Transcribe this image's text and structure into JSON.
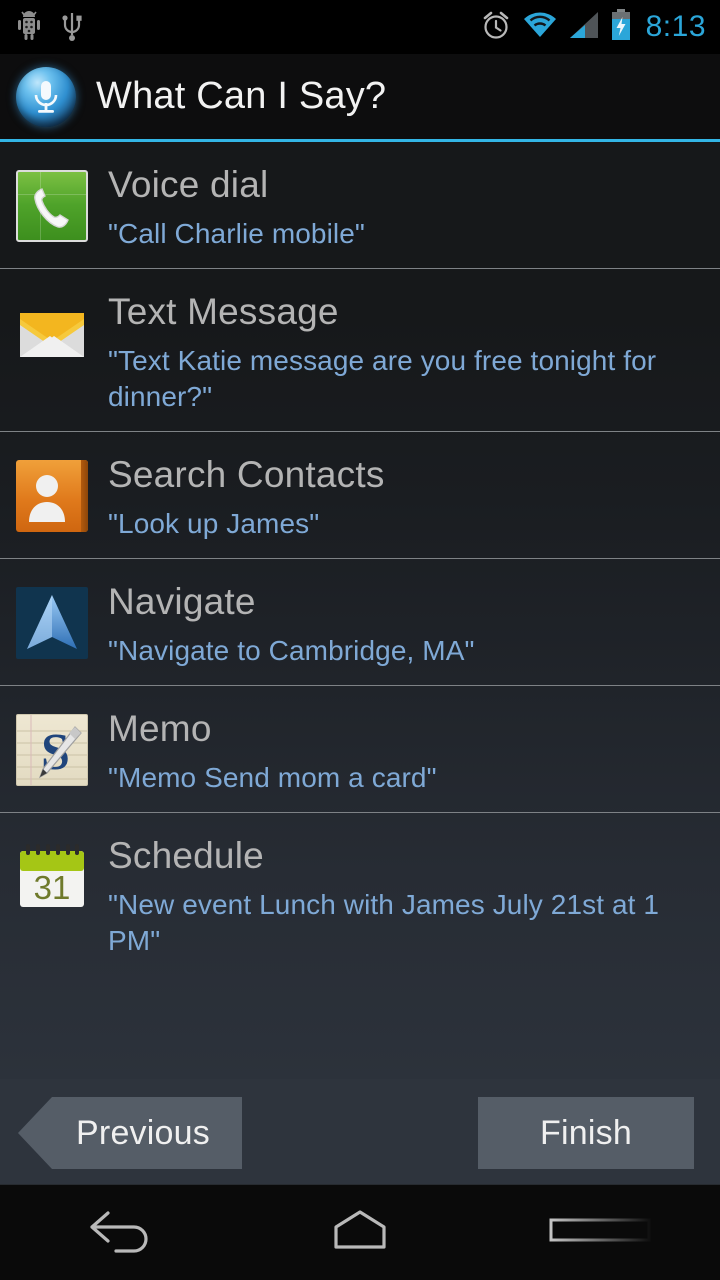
{
  "statusbar": {
    "icons": [
      "android-debug-icon",
      "usb-icon",
      "alarm-clock-icon",
      "wifi-icon",
      "cell-signal-icon",
      "battery-charging-icon"
    ],
    "clock": "8:13",
    "clock_color": "#2ba6d9"
  },
  "titlebar": {
    "icon": "microphone-orb-icon",
    "title": "What Can I Say?",
    "accent_color": "#33b5e5"
  },
  "list": {
    "items": [
      {
        "icon": "phone-icon",
        "title": "Voice dial",
        "example": "\"Call Charlie mobile\""
      },
      {
        "icon": "envelope-icon",
        "title": "Text Message",
        "example": "\"Text Katie message are you free tonight for dinner?\""
      },
      {
        "icon": "contact-icon",
        "title": "Search Contacts",
        "example": "\"Look up James\""
      },
      {
        "icon": "navigation-arrow-icon",
        "title": "Navigate",
        "example": "\"Navigate to Cambridge, MA\""
      },
      {
        "icon": "memo-icon",
        "title": "Memo",
        "example": "\"Memo Send mom a card\""
      },
      {
        "icon": "calendar-icon",
        "title": "Schedule",
        "example": "\"New event Lunch with James July 21st at 1 PM\""
      }
    ],
    "title_color": "#b4b4b4",
    "example_color": "#7fa9d6"
  },
  "buttons": {
    "previous_label": "Previous",
    "finish_label": "Finish"
  },
  "navbar": {
    "back_label": "back-icon",
    "home_label": "home-icon",
    "recents_label": "recents-icon"
  },
  "calendar": {
    "day": "31"
  },
  "memo": {
    "letter": "S"
  }
}
